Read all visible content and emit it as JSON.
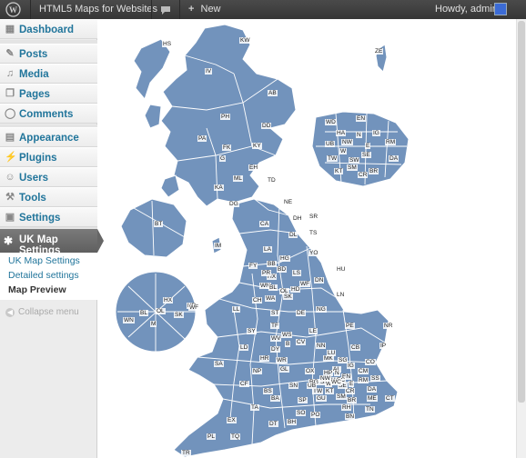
{
  "adminbar": {
    "site_name": "HTML5 Maps for Websites",
    "new_label": "New",
    "howdy": "Howdy, admin"
  },
  "sidebar": {
    "items": [
      {
        "label": "Dashboard",
        "icon": "dashboard-icon"
      },
      {
        "label": "Posts",
        "icon": "pin-icon"
      },
      {
        "label": "Media",
        "icon": "media-icon"
      },
      {
        "label": "Pages",
        "icon": "pages-icon"
      },
      {
        "label": "Comments",
        "icon": "comment-icon"
      },
      {
        "label": "Appearance",
        "icon": "appearance-icon"
      },
      {
        "label": "Plugins",
        "icon": "plugin-icon"
      },
      {
        "label": "Users",
        "icon": "users-icon"
      },
      {
        "label": "Tools",
        "icon": "tools-icon"
      },
      {
        "label": "Settings",
        "icon": "settings-icon"
      }
    ],
    "active": {
      "label": "UK Map Settings",
      "icon": "gear-icon"
    },
    "submenu": [
      "UK Map Settings",
      "Detailed settings",
      "Map Preview"
    ],
    "collapse_label": "Collapse menu"
  },
  "map": {
    "fill_color": "#7293bc",
    "border_color": "#ffffff",
    "labels": [
      "HS",
      "KW",
      "IV",
      "AB",
      "PH",
      "DD",
      "PA",
      "FK",
      "KY",
      "G",
      "EH",
      "ML",
      "KA",
      "TD",
      "DG",
      "NE",
      "DH",
      "SR",
      "CA",
      "BT",
      "TS",
      "IM",
      "LA",
      "DL",
      "HG",
      "YO",
      "HU",
      "BD",
      "LS",
      "HX",
      "FY",
      "BB",
      "PR",
      "WN",
      "BL",
      "OL",
      "HD",
      "WF",
      "DN",
      "LN",
      "CH",
      "WA",
      "SK",
      "DE",
      "NG",
      "LL",
      "ST",
      "LE",
      "PE",
      "NR",
      "SY",
      "TF",
      "WS",
      "B",
      "WV",
      "DY",
      "CV",
      "NN",
      "MK",
      "CB",
      "IP",
      "LD",
      "WR",
      "HR",
      "SG",
      "AL",
      "CO",
      "SA",
      "GL",
      "OX",
      "HP",
      "LU",
      "CM",
      "SS",
      "NP",
      "CF",
      "SN",
      "RG",
      "SL",
      "HA",
      "EN",
      "IG",
      "RM",
      "DA",
      "BS",
      "BA",
      "SP",
      "GU",
      "KT",
      "SM",
      "CR",
      "BR",
      "SE",
      "N",
      "E",
      "W",
      "NW",
      "EC",
      "WC",
      "TW",
      "UB",
      "ME",
      "CT",
      "TN",
      "RH",
      "BN",
      "PO",
      "SO",
      "BH",
      "DT",
      "TA",
      "EX",
      "TQ",
      "PL",
      "TR",
      "ZE"
    ],
    "london_labels": [
      "WD",
      "EN",
      "HA",
      "NW",
      "N",
      "IG",
      "UB",
      "W",
      "E",
      "RM",
      "TW",
      "SW",
      "SE",
      "DA",
      "KT",
      "SM",
      "CR",
      "BR"
    ],
    "manchester_labels": [
      "BL",
      "OL",
      "HX",
      "WN",
      "M",
      "SK",
      "HD",
      "WF"
    ]
  }
}
